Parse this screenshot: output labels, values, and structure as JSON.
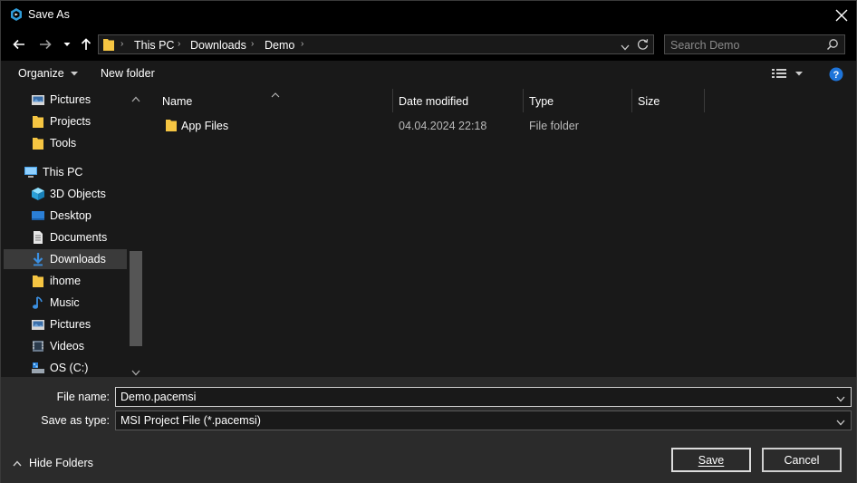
{
  "window": {
    "title": "Save As"
  },
  "address": {
    "crumbs": [
      "This PC",
      "Downloads",
      "Demo"
    ]
  },
  "search": {
    "placeholder": "Search Demo"
  },
  "toolbar": {
    "organize_label": "Organize",
    "new_folder_label": "New folder"
  },
  "nav": {
    "items": [
      {
        "label": "Pictures",
        "icon": "pictures-icon",
        "root": false
      },
      {
        "label": "Projects",
        "icon": "folder-icon",
        "root": false
      },
      {
        "label": "Tools",
        "icon": "folder-icon",
        "root": false
      },
      {
        "label": "This PC",
        "icon": "computer-icon",
        "root": true
      },
      {
        "label": "3D Objects",
        "icon": "cube-icon",
        "root": false
      },
      {
        "label": "Desktop",
        "icon": "desktop-icon",
        "root": false
      },
      {
        "label": "Documents",
        "icon": "documents-icon",
        "root": false
      },
      {
        "label": "Downloads",
        "icon": "download-arrow-icon",
        "root": false,
        "selected": true
      },
      {
        "label": "ihome",
        "icon": "folder-icon",
        "root": false
      },
      {
        "label": "Music",
        "icon": "music-note-icon",
        "root": false
      },
      {
        "label": "Pictures",
        "icon": "pictures-icon",
        "root": false
      },
      {
        "label": "Videos",
        "icon": "videos-icon",
        "root": false
      },
      {
        "label": "OS (C:)",
        "icon": "drive-icon",
        "root": false
      }
    ]
  },
  "columns": {
    "name": "Name",
    "date_modified": "Date modified",
    "type": "Type",
    "size": "Size"
  },
  "files": [
    {
      "name": "App Files",
      "date_modified": "04.04.2024 22:18",
      "type": "File folder",
      "size": ""
    }
  ],
  "form": {
    "file_name_label": "File name:",
    "file_name_value": "Demo.pacemsi",
    "save_type_label": "Save as type:",
    "save_type_value": "MSI Project File (*.pacemsi)"
  },
  "footer": {
    "hide_folders_label": "Hide Folders",
    "save_label": "Save",
    "cancel_label": "Cancel"
  },
  "colors": {
    "folder": "#f5c542",
    "accent_blue": "#2b7fd6",
    "help_blue": "#1e74d9"
  }
}
